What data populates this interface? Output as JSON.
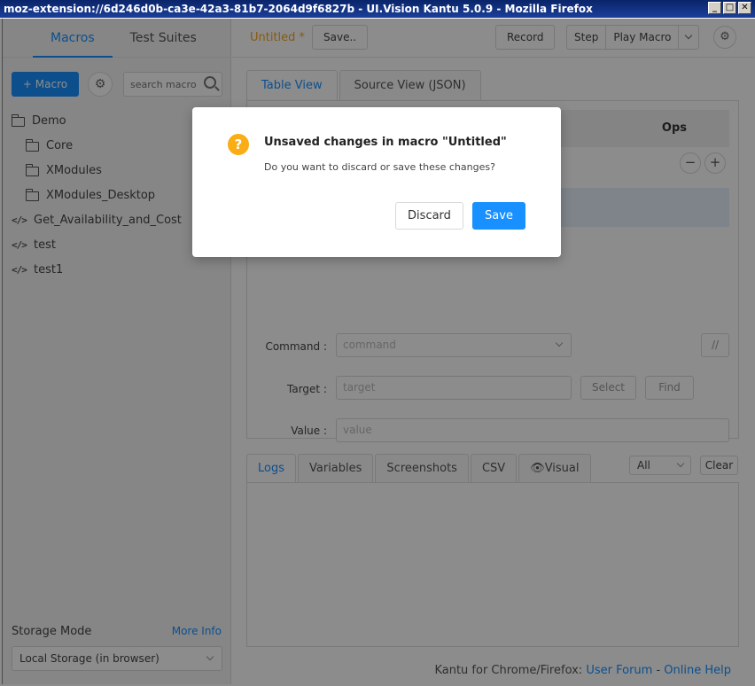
{
  "window": {
    "title": "moz-extension://6d246d0b-ca3e-42a3-81b7-2064d9f6827b - UI.Vision Kantu 5.0.9 - Mozilla Firefox",
    "min": "_",
    "max": "□",
    "close": "✕"
  },
  "sidebar": {
    "tabs": [
      {
        "label": "Macros"
      },
      {
        "label": "Test Suites"
      }
    ],
    "add_macro": "+ Macro",
    "search_placeholder": "search macro",
    "tree": [
      {
        "label": "Demo",
        "icon": "folder-open-icon"
      },
      {
        "label": "Core",
        "icon": "folder-icon"
      },
      {
        "label": "XModules",
        "icon": "folder-icon"
      },
      {
        "label": "XModules_Desktop",
        "icon": "folder-icon"
      },
      {
        "label": "Get_Availability_and_Cost",
        "icon": "code-icon"
      },
      {
        "label": "test",
        "icon": "code-icon"
      },
      {
        "label": "test1",
        "icon": "code-icon"
      }
    ],
    "storage_label": "Storage Mode",
    "more_info": "More Info",
    "storage_value": "Local Storage (in browser)"
  },
  "toolbar": {
    "macro_name": "Untitled *",
    "save": "Save..",
    "record": "Record",
    "step": "Step",
    "play": "Play Macro"
  },
  "editor": {
    "tabs": [
      {
        "label": "Table View"
      },
      {
        "label": "Source View (JSON)"
      }
    ],
    "ops_header": "Ops",
    "minus": "−",
    "plus": "+",
    "command_label": "Command :",
    "command_placeholder": "command",
    "comment_btn": "//",
    "target_label": "Target :",
    "target_placeholder": "target",
    "select_btn": "Select",
    "find_btn": "Find",
    "value_label": "Value :",
    "value_placeholder": "value"
  },
  "logs": {
    "tabs": [
      {
        "label": "Logs"
      },
      {
        "label": "Variables"
      },
      {
        "label": "Screenshots"
      },
      {
        "label": "CSV"
      },
      {
        "label": "👁Visual"
      }
    ],
    "filter": "All",
    "clear": "Clear"
  },
  "footer": {
    "text": "Kantu for Chrome/Firefox:",
    "forum": "User Forum",
    "sep": " - ",
    "help": "Online Help"
  },
  "modal": {
    "icon": "?",
    "title": "Unsaved changes in macro \"Untitled\"",
    "text": "Do you want to discard or save these changes?",
    "discard": "Discard",
    "save": "Save"
  },
  "colors": {
    "accent": "#1890ff",
    "warning": "#faad14",
    "unsaved": "#f5a623"
  }
}
